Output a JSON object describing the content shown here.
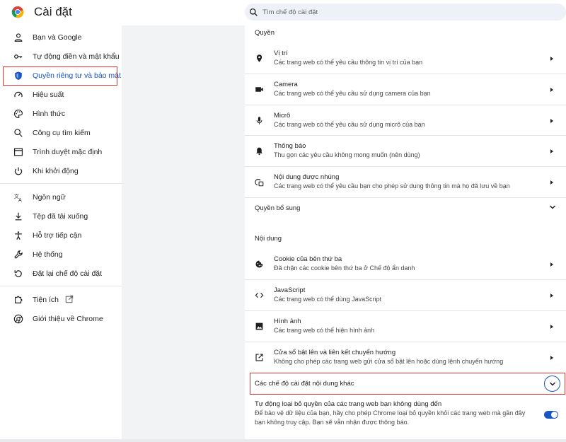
{
  "header": {
    "title": "Cài đặt",
    "search_placeholder": "Tìm chế độ cài đặt",
    "logo_icon": "chrome-logo-icon"
  },
  "sidebar": {
    "items": [
      {
        "label": "Bạn và Google",
        "icon": "person-icon"
      },
      {
        "label": "Tự động điền và mật khẩu",
        "icon": "key-icon"
      },
      {
        "label": "Quyền riêng tư và bảo mật",
        "icon": "shield-icon",
        "active": true
      },
      {
        "label": "Hiệu suất",
        "icon": "speedometer-icon"
      },
      {
        "label": "Hình thức",
        "icon": "palette-icon"
      },
      {
        "label": "Công cụ tìm kiếm",
        "icon": "search-icon"
      },
      {
        "label": "Trình duyệt mặc định",
        "icon": "browser-icon"
      },
      {
        "label": "Khi khởi động",
        "icon": "power-icon"
      },
      {
        "label": "Ngôn ngữ",
        "icon": "translate-icon"
      },
      {
        "label": "Tệp đã tải xuống",
        "icon": "download-icon"
      },
      {
        "label": "Hỗ trợ tiếp cận",
        "icon": "accessibility-icon"
      },
      {
        "label": "Hệ thống",
        "icon": "wrench-icon"
      },
      {
        "label": "Đặt lại chế độ cài đặt",
        "icon": "reset-icon"
      },
      {
        "label": "Tiện ích",
        "icon": "puzzle-icon"
      },
      {
        "label": "Giới thiệu về Chrome",
        "icon": "chrome-icon"
      }
    ]
  },
  "main": {
    "permissions_title": "Quyền",
    "permissions": [
      {
        "title": "Vị trí",
        "desc": "Các trang web có thể yêu cầu thông tin vị trí của bạn",
        "icon": "location-pin-icon"
      },
      {
        "title": "Camera",
        "desc": "Các trang web có thể yêu cầu sử dụng camera của bạn",
        "icon": "camera-icon"
      },
      {
        "title": "Micrô",
        "desc": "Các trang web có thể yêu cầu sử dụng micrô của bạn",
        "icon": "microphone-icon"
      },
      {
        "title": "Thông báo",
        "desc": "Thu gọn các yêu cầu không mong muốn (nên dùng)",
        "icon": "bell-icon"
      },
      {
        "title": "Nội dung được nhúng",
        "desc": "Các trang web có thể yêu cầu bạn cho phép sử dụng thông tin mà họ đã lưu về bạn",
        "icon": "embedded-content-icon"
      }
    ],
    "additional_permissions": "Quyền bổ sung",
    "content_title": "Nội dung",
    "content": [
      {
        "title": "Cookie của bên thứ ba",
        "desc": "Đã chặn các cookie bên thứ ba ở Chế độ ẩn danh",
        "icon": "cookie-icon"
      },
      {
        "title": "JavaScript",
        "desc": "Các trang web có thể dùng JavaScript",
        "icon": "code-icon"
      },
      {
        "title": "Hình ảnh",
        "desc": "Các trang web có thể hiện hình ảnh",
        "icon": "image-icon"
      },
      {
        "title": "Cửa sổ bật lên và liên kết chuyển hướng",
        "desc": "Không cho phép các trang web gửi cửa sổ bật lên hoặc dùng lệnh chuyển hướng",
        "icon": "open-external-icon"
      }
    ],
    "additional_content": "Các chế độ cài đặt nội dung khác",
    "auto_revoke": {
      "title": "Tự động loại bỏ quyền của các trang web bạn không dùng đến",
      "desc_line1": "Để bảo vệ dữ liệu của bạn, hãy cho phép Chrome loại bỏ quyền khỏi các trang web mà gần đây",
      "desc_line2": "bạn không truy cập. Bạn sẽ vẫn nhận được thông báo.",
      "enabled": true
    }
  },
  "colors": {
    "accent": "#1a56c4",
    "highlight_border": "#e03131"
  }
}
